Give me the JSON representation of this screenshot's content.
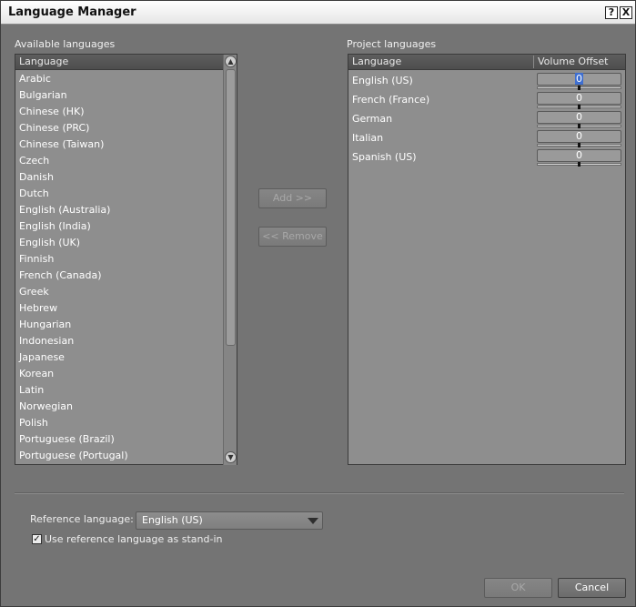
{
  "window": {
    "title": "Language Manager",
    "help_label": "?",
    "close_label": "X"
  },
  "available": {
    "label": "Available languages",
    "column": "Language",
    "items": [
      "Arabic",
      "Bulgarian",
      "Chinese (HK)",
      "Chinese (PRC)",
      "Chinese (Taiwan)",
      "Czech",
      "Danish",
      "Dutch",
      "English (Australia)",
      "English (India)",
      "English (UK)",
      "Finnish",
      "French (Canada)",
      "Greek",
      "Hebrew",
      "Hungarian",
      "Indonesian",
      "Japanese",
      "Korean",
      "Latin",
      "Norwegian",
      "Polish",
      "Portuguese (Brazil)",
      "Portuguese (Portugal)"
    ]
  },
  "buttons": {
    "add": "Add >>",
    "remove": "<< Remove",
    "ok": "OK",
    "cancel": "Cancel"
  },
  "project": {
    "label": "Project languages",
    "col_language": "Language",
    "col_volume": "Volume Offset",
    "rows": [
      {
        "name": "English (US)",
        "offset": "0"
      },
      {
        "name": "French (France)",
        "offset": "0"
      },
      {
        "name": "German",
        "offset": "0"
      },
      {
        "name": "Italian",
        "offset": "0"
      },
      {
        "name": "Spanish (US)",
        "offset": "0"
      }
    ]
  },
  "reference": {
    "label": "Reference language:",
    "value": "English (US)",
    "standin_label": "Use reference language as stand-in",
    "standin_checked": true,
    "check_glyph": "✓"
  }
}
